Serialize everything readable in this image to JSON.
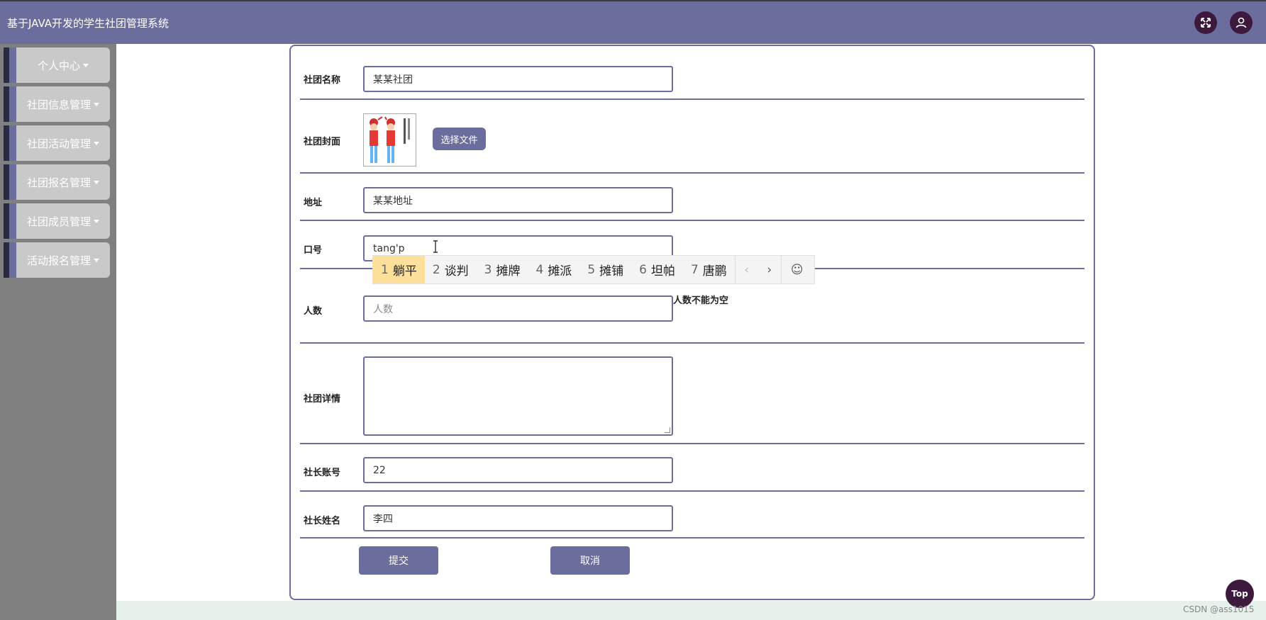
{
  "header": {
    "title": "基于JAVA开发的学生社团管理系统",
    "fullscreen_icon": "expand-arrows-icon",
    "user_icon": "user-icon"
  },
  "sidebar": {
    "items": [
      {
        "label": "个人中心"
      },
      {
        "label": "社团信息管理"
      },
      {
        "label": "社团活动管理"
      },
      {
        "label": "社团报名管理"
      },
      {
        "label": "社团成员管理"
      },
      {
        "label": "活动报名管理"
      }
    ]
  },
  "form": {
    "club_name": {
      "label": "社团名称",
      "value": "某某社团"
    },
    "cover": {
      "label": "社团封面",
      "button": "选择文件"
    },
    "address": {
      "label": "地址",
      "value": "某某地址"
    },
    "slogan": {
      "label": "口号",
      "value": "tang'p"
    },
    "members": {
      "label": "人数",
      "placeholder": "人数",
      "error": "人数不能为空"
    },
    "details": {
      "label": "社团详情",
      "value": ""
    },
    "leader_account": {
      "label": "社长账号",
      "value": "22"
    },
    "leader_name": {
      "label": "社长姓名",
      "value": "李四"
    },
    "submit": "提交",
    "cancel": "取消"
  },
  "ime": {
    "candidates": [
      {
        "num": "1",
        "text": "躺平"
      },
      {
        "num": "2",
        "text": "谈判"
      },
      {
        "num": "3",
        "text": "摊牌"
      },
      {
        "num": "4",
        "text": "摊派"
      },
      {
        "num": "5",
        "text": "摊铺"
      },
      {
        "num": "6",
        "text": "坦帕"
      },
      {
        "num": "7",
        "text": "唐鹏"
      }
    ],
    "prev": "‹",
    "next": "›",
    "emoji": "☺"
  },
  "top_button": "Top",
  "watermark": "CSDN @ass1015",
  "colors": {
    "primary": "#6b6d9d",
    "sidebar_bg": "#808080",
    "ime_highlight": "#fde19a",
    "icon_bg": "#3d1a3d"
  }
}
